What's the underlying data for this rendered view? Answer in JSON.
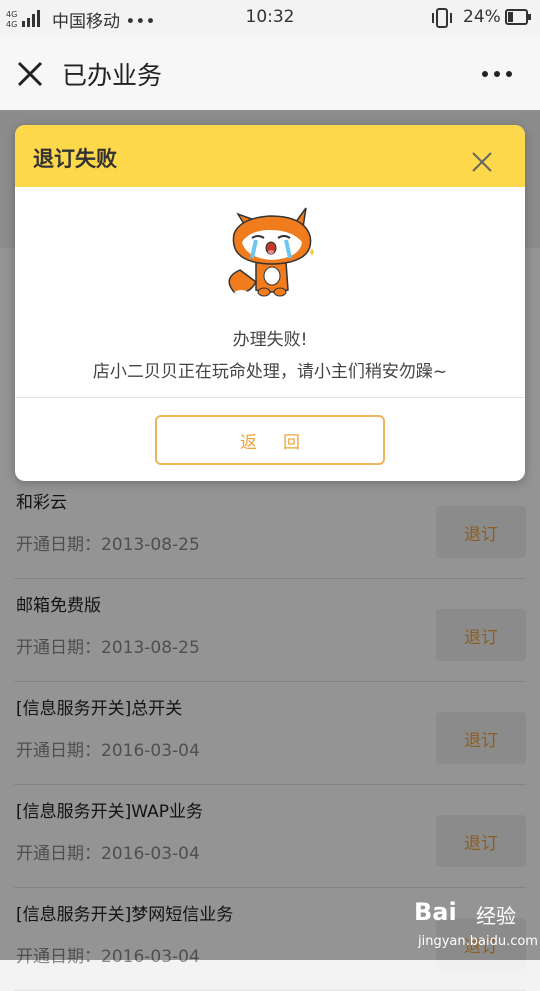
{
  "status_bar": {
    "signal_label": "4G 4G",
    "carrier": "中国移动 •••",
    "time": "10:32",
    "battery_percent": "24%"
  },
  "title_bar": {
    "title": "已办业务"
  },
  "list": [
    {
      "name": "和彩云",
      "date": "开通日期：2013-08-25",
      "button": "退订"
    },
    {
      "name": "邮箱免费版",
      "date": "开通日期：2013-08-25",
      "button": "退订"
    },
    {
      "name": "[信息服务开关]总开关",
      "date": "开通日期：2016-03-04",
      "button": "退订"
    },
    {
      "name": "[信息服务开关]WAP业务",
      "date": "开通日期：2016-03-04",
      "button": "退订"
    },
    {
      "name": "[信息服务开关]梦网短信业务",
      "date": "开通日期：2016-03-04",
      "button": "退订"
    }
  ],
  "dialog": {
    "title": "退订失败",
    "message_line1": "办理失败!",
    "message_line2": "店小二贝贝正在玩命处理，请小主们稍安勿躁~",
    "back_button": "返回"
  },
  "watermark": {
    "logo": "Bai",
    "logo_suffix": "经验",
    "url": "jingyan.baidu.com"
  },
  "colors": {
    "dialog_header": "#fdd84a",
    "accent": "#f2a23a",
    "mask": "rgba(0,0,0,0.42)"
  }
}
